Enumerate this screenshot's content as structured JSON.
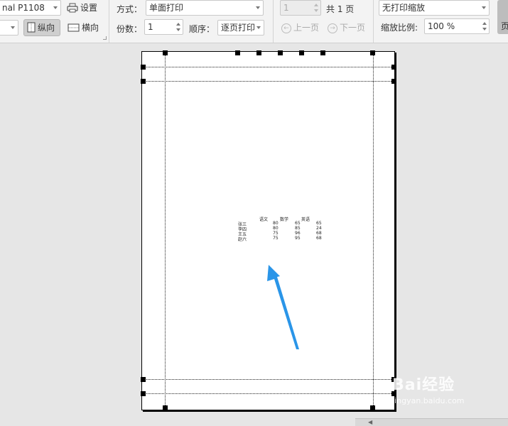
{
  "toolbar": {
    "printer": "nal P1108",
    "settings_label": "设置",
    "portrait_label": "纵向",
    "landscape_label": "横向",
    "mode_label": "方式：",
    "mode_value": "单面打印",
    "copies_label": "份数：",
    "copies_value": "1",
    "order_label": "顺序：",
    "order_value": "逐页打印",
    "page_value": "1",
    "total_pages": "共 1 页",
    "prev_page": "上一页",
    "next_page": "下一页",
    "scaling_value": "无打印缩放",
    "zoom_label": "缩放比例:",
    "zoom_value": "100 %",
    "right_edge_label": "页"
  },
  "sheet": {
    "headers": [
      "语文",
      "数学",
      "英语"
    ],
    "rows": [
      {
        "name": "张三",
        "values": [
          "80",
          "65",
          "65"
        ]
      },
      {
        "name": "李四",
        "values": [
          "80",
          "85",
          "24"
        ]
      },
      {
        "name": "王五",
        "values": [
          "75",
          "96",
          "68"
        ]
      },
      {
        "name": "赵六",
        "values": [
          "75",
          "95",
          "68"
        ]
      }
    ]
  },
  "watermark": {
    "logo": "Bai经验",
    "url": "jingyan.baidu.com"
  },
  "colors": {
    "arrow": "#2a95e8",
    "toolbar_bg": "#f3f3f3",
    "workspace_bg": "#e6e6e6"
  }
}
